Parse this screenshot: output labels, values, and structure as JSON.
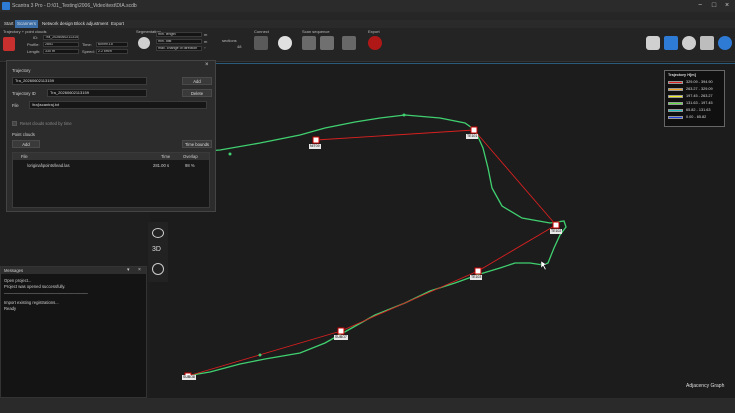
{
  "window": {
    "title": "Scantra 3 Pro - D:\\01_Testing\\2006_Video\\test\\DIA.scdb",
    "minimize": "−",
    "maximize": "□",
    "close": "×"
  },
  "tabs": [
    "Start",
    "Scanners",
    "Network design",
    "Block adjustment",
    "Export"
  ],
  "ribbon": {
    "group_trajectory": "Trajectory + point clouds",
    "id_label": "ID:",
    "id_value": "Tra_20260602113159",
    "profile_label": "Profile:",
    "profile_value": "2851",
    "time_label": "Time:",
    "time_value": "60x99.15",
    "length_label": "Length:",
    "length_value": "330 m",
    "speed_label": "Speed:",
    "speed_value": "2.2 km/h",
    "group_segmentation": "Segmentation",
    "seg_min_length": "min. length",
    "seg_min_dist": "min. dist",
    "seg_max_change": "max. change of direction",
    "seg_unit_m": "m",
    "seg_unit_deg": "°",
    "sections_label": "sections",
    "sections_value": "48",
    "group_connect": "Connect",
    "group_scan_sequence": "Scan sequence",
    "group_export": "Export"
  },
  "dialog": {
    "close": "×",
    "trajectory_section": "Trajectory",
    "trajectory_select": "Tra_20260602113159",
    "add_button": "Add",
    "traj_id_label": "Trajectory ID",
    "traj_id_value": "Tra_20260602113159",
    "delete_button": "Delete",
    "file_label": "File",
    "file_value": "\\traj\\scantraj.txt",
    "reset_checkbox_label": "Reset clouds sorted by time",
    "point_clouds_section": "Point clouds",
    "add_pc_button": "Add",
    "time_bounds_button": "Time bounds",
    "columns": [
      "File",
      "Time",
      "Overlap"
    ],
    "rows": [
      {
        "file": "\\original\\points\\lead.las",
        "time": "281.00 s",
        "overlap": "98 %"
      }
    ]
  },
  "messages": {
    "title": "Messages",
    "lines": [
      "Open project...",
      "Project was opened successfully.",
      "____________________________________",
      "Import existing registrations...",
      "Ready"
    ]
  },
  "side_tools": {
    "view3d_label": "3D"
  },
  "legend": {
    "title": "Trajectory H[m]",
    "entries": [
      {
        "range": "329.09 - 394.90",
        "color": "#e02020"
      },
      {
        "range": "263.27 - 329.09",
        "color": "#f0a020"
      },
      {
        "range": "197.45 - 263.27",
        "color": "#f0f020"
      },
      {
        "range": "131.63 - 197.45",
        "color": "#60e040"
      },
      {
        "range": "65.82 - 131.63",
        "color": "#20c0c0"
      },
      {
        "range": "0.00 - 65.82",
        "color": "#2040e0"
      }
    ]
  },
  "viewport": {
    "watermark": "Adjacency Graph",
    "waypoints": [
      "NIT09",
      "TE101",
      "TE102",
      "TE103",
      "SUBO7",
      "SUBO8",
      "ROTS9"
    ]
  },
  "colors": {
    "trajectory": "#40d070",
    "connection": "#d82020",
    "waypoint_border": "#cc0000"
  }
}
